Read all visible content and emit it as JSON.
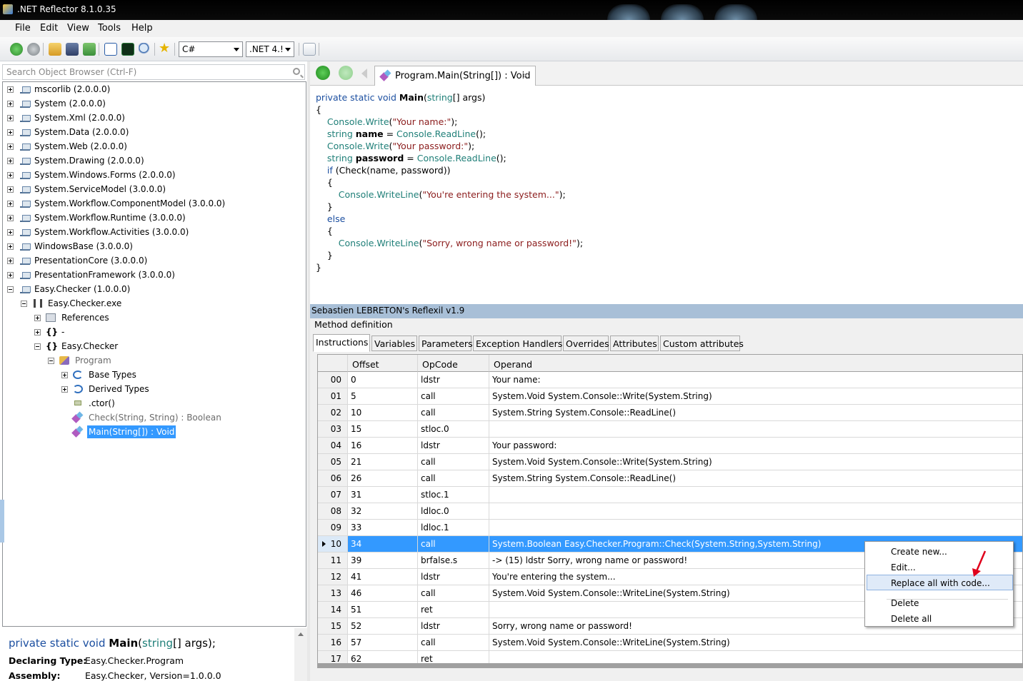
{
  "window": {
    "title": ".NET Reflector 8.1.0.35"
  },
  "menu": [
    "File",
    "Edit",
    "View",
    "Tools",
    "Help"
  ],
  "toolbar": {
    "language": "C#",
    "framework": ".NET 4.!"
  },
  "search": {
    "placeholder": "Search Object Browser (Ctrl-F)"
  },
  "tree": [
    {
      "label": "mscorlib (2.0.0.0)"
    },
    {
      "label": "System (2.0.0.0)"
    },
    {
      "label": "System.Xml (2.0.0.0)"
    },
    {
      "label": "System.Data (2.0.0.0)"
    },
    {
      "label": "System.Web (2.0.0.0)"
    },
    {
      "label": "System.Drawing (2.0.0.0)"
    },
    {
      "label": "System.Windows.Forms (2.0.0.0)"
    },
    {
      "label": "System.ServiceModel (3.0.0.0)"
    },
    {
      "label": "System.Workflow.ComponentModel (3.0.0.0)"
    },
    {
      "label": "System.Workflow.Runtime (3.0.0.0)"
    },
    {
      "label": "System.Workflow.Activities (3.0.0.0)"
    },
    {
      "label": "WindowsBase (3.0.0.0)"
    },
    {
      "label": "PresentationCore (3.0.0.0)"
    },
    {
      "label": "PresentationFramework (3.0.0.0)"
    },
    {
      "label": "Easy.Checker (1.0.0.0)"
    },
    {
      "label": "Easy.Checker.exe"
    },
    {
      "label": "References"
    },
    {
      "label": "-"
    },
    {
      "label": "Easy.Checker"
    },
    {
      "label": "Program"
    },
    {
      "label": "Base Types"
    },
    {
      "label": "Derived Types"
    },
    {
      "label": ".ctor()"
    },
    {
      "label": "Check(String, String) : Boolean"
    },
    {
      "label": "Main(String[]) : Void"
    }
  ],
  "info": {
    "sig_kw": "private static void",
    "sig_name": "Main",
    "sig_type": "string",
    "sig_rest": "[] args);",
    "declaring_label": "Declaring Type:",
    "declaring_value": "Easy.Checker.Program",
    "assembly_label": "Assembly:",
    "assembly_value": "Easy.Checker, Version=1.0.0.0"
  },
  "document_tab": {
    "title": "Program.Main(String[]) : Void",
    "close": "×"
  },
  "code": {
    "l1_kw": "private static void",
    "l1_name": "Main",
    "l1_paren": "(",
    "l1_type": "string",
    "l1_rest": "[] args)",
    "open": "{",
    "close": "}",
    "cw1_call": "Console.Write",
    "cw1_arg": "\"Your name:\"",
    "cw1_end": ");",
    "rl1_type": "string",
    "rl1_name": "name",
    "rl1_eq": " = ",
    "rl1_call": "Console.ReadLine",
    "rl1_end": "();",
    "cw2_call": "Console.Write",
    "cw2_arg": "\"Your password:\"",
    "cw2_end": ");",
    "rl2_type": "string",
    "rl2_name": "password",
    "rl2_eq": " = ",
    "rl2_call": "Console.ReadLine",
    "rl2_end": "();",
    "if_kw": "if",
    "if_rest": " (Check(name, password))",
    "wl1_call": "Console.WriteLine",
    "wl1_arg": "\"You're entering the system...\"",
    "wl1_end": ");",
    "else_kw": "else",
    "wl2_call": "Console.WriteLine",
    "wl2_arg": "\"Sorry, wrong name or password!\"",
    "wl2_end": ");"
  },
  "reflexil": {
    "title": "Sebastien LEBRETON's Reflexil v1.9",
    "section": "Method definition",
    "tabs": [
      "Instructions",
      "Variables",
      "Parameters",
      "Exception Handlers",
      "Overrides",
      "Attributes",
      "Custom attributes"
    ],
    "columns": [
      "Offset",
      "OpCode",
      "Operand"
    ],
    "rows": [
      {
        "idx": "00",
        "offset": "0",
        "opcode": "ldstr",
        "operand": "Your name:"
      },
      {
        "idx": "01",
        "offset": "5",
        "opcode": "call",
        "operand": "System.Void System.Console::Write(System.String)"
      },
      {
        "idx": "02",
        "offset": "10",
        "opcode": "call",
        "operand": "System.String System.Console::ReadLine()"
      },
      {
        "idx": "03",
        "offset": "15",
        "opcode": "stloc.0",
        "operand": ""
      },
      {
        "idx": "04",
        "offset": "16",
        "opcode": "ldstr",
        "operand": "Your password:"
      },
      {
        "idx": "05",
        "offset": "21",
        "opcode": "call",
        "operand": "System.Void System.Console::Write(System.String)"
      },
      {
        "idx": "06",
        "offset": "26",
        "opcode": "call",
        "operand": "System.String System.Console::ReadLine()"
      },
      {
        "idx": "07",
        "offset": "31",
        "opcode": "stloc.1",
        "operand": ""
      },
      {
        "idx": "08",
        "offset": "32",
        "opcode": "ldloc.0",
        "operand": ""
      },
      {
        "idx": "09",
        "offset": "33",
        "opcode": "ldloc.1",
        "operand": ""
      },
      {
        "idx": "10",
        "offset": "34",
        "opcode": "call",
        "operand": "System.Boolean Easy.Checker.Program::Check(System.String,System.String)"
      },
      {
        "idx": "11",
        "offset": "39",
        "opcode": "brfalse.s",
        "operand": "-> (15) ldstr Sorry, wrong name or password!"
      },
      {
        "idx": "12",
        "offset": "41",
        "opcode": "ldstr",
        "operand": "You're entering the system..."
      },
      {
        "idx": "13",
        "offset": "46",
        "opcode": "call",
        "operand": "System.Void System.Console::WriteLine(System.String)"
      },
      {
        "idx": "14",
        "offset": "51",
        "opcode": "ret",
        "operand": ""
      },
      {
        "idx": "15",
        "offset": "52",
        "opcode": "ldstr",
        "operand": "Sorry, wrong name or password!"
      },
      {
        "idx": "16",
        "offset": "57",
        "opcode": "call",
        "operand": "System.Void System.Console::WriteLine(System.String)"
      },
      {
        "idx": "17",
        "offset": "62",
        "opcode": "ret",
        "operand": ""
      }
    ]
  },
  "context_menu": [
    "Create new...",
    "Edit...",
    "Replace all with code...",
    "Delete",
    "Delete all"
  ],
  "colors": {
    "selection": "#3399ff",
    "keyword": "#1c4fa0",
    "type": "#1f7f78",
    "string": "#8b1c1c",
    "reflexil_bar": "#a8bfd7"
  }
}
